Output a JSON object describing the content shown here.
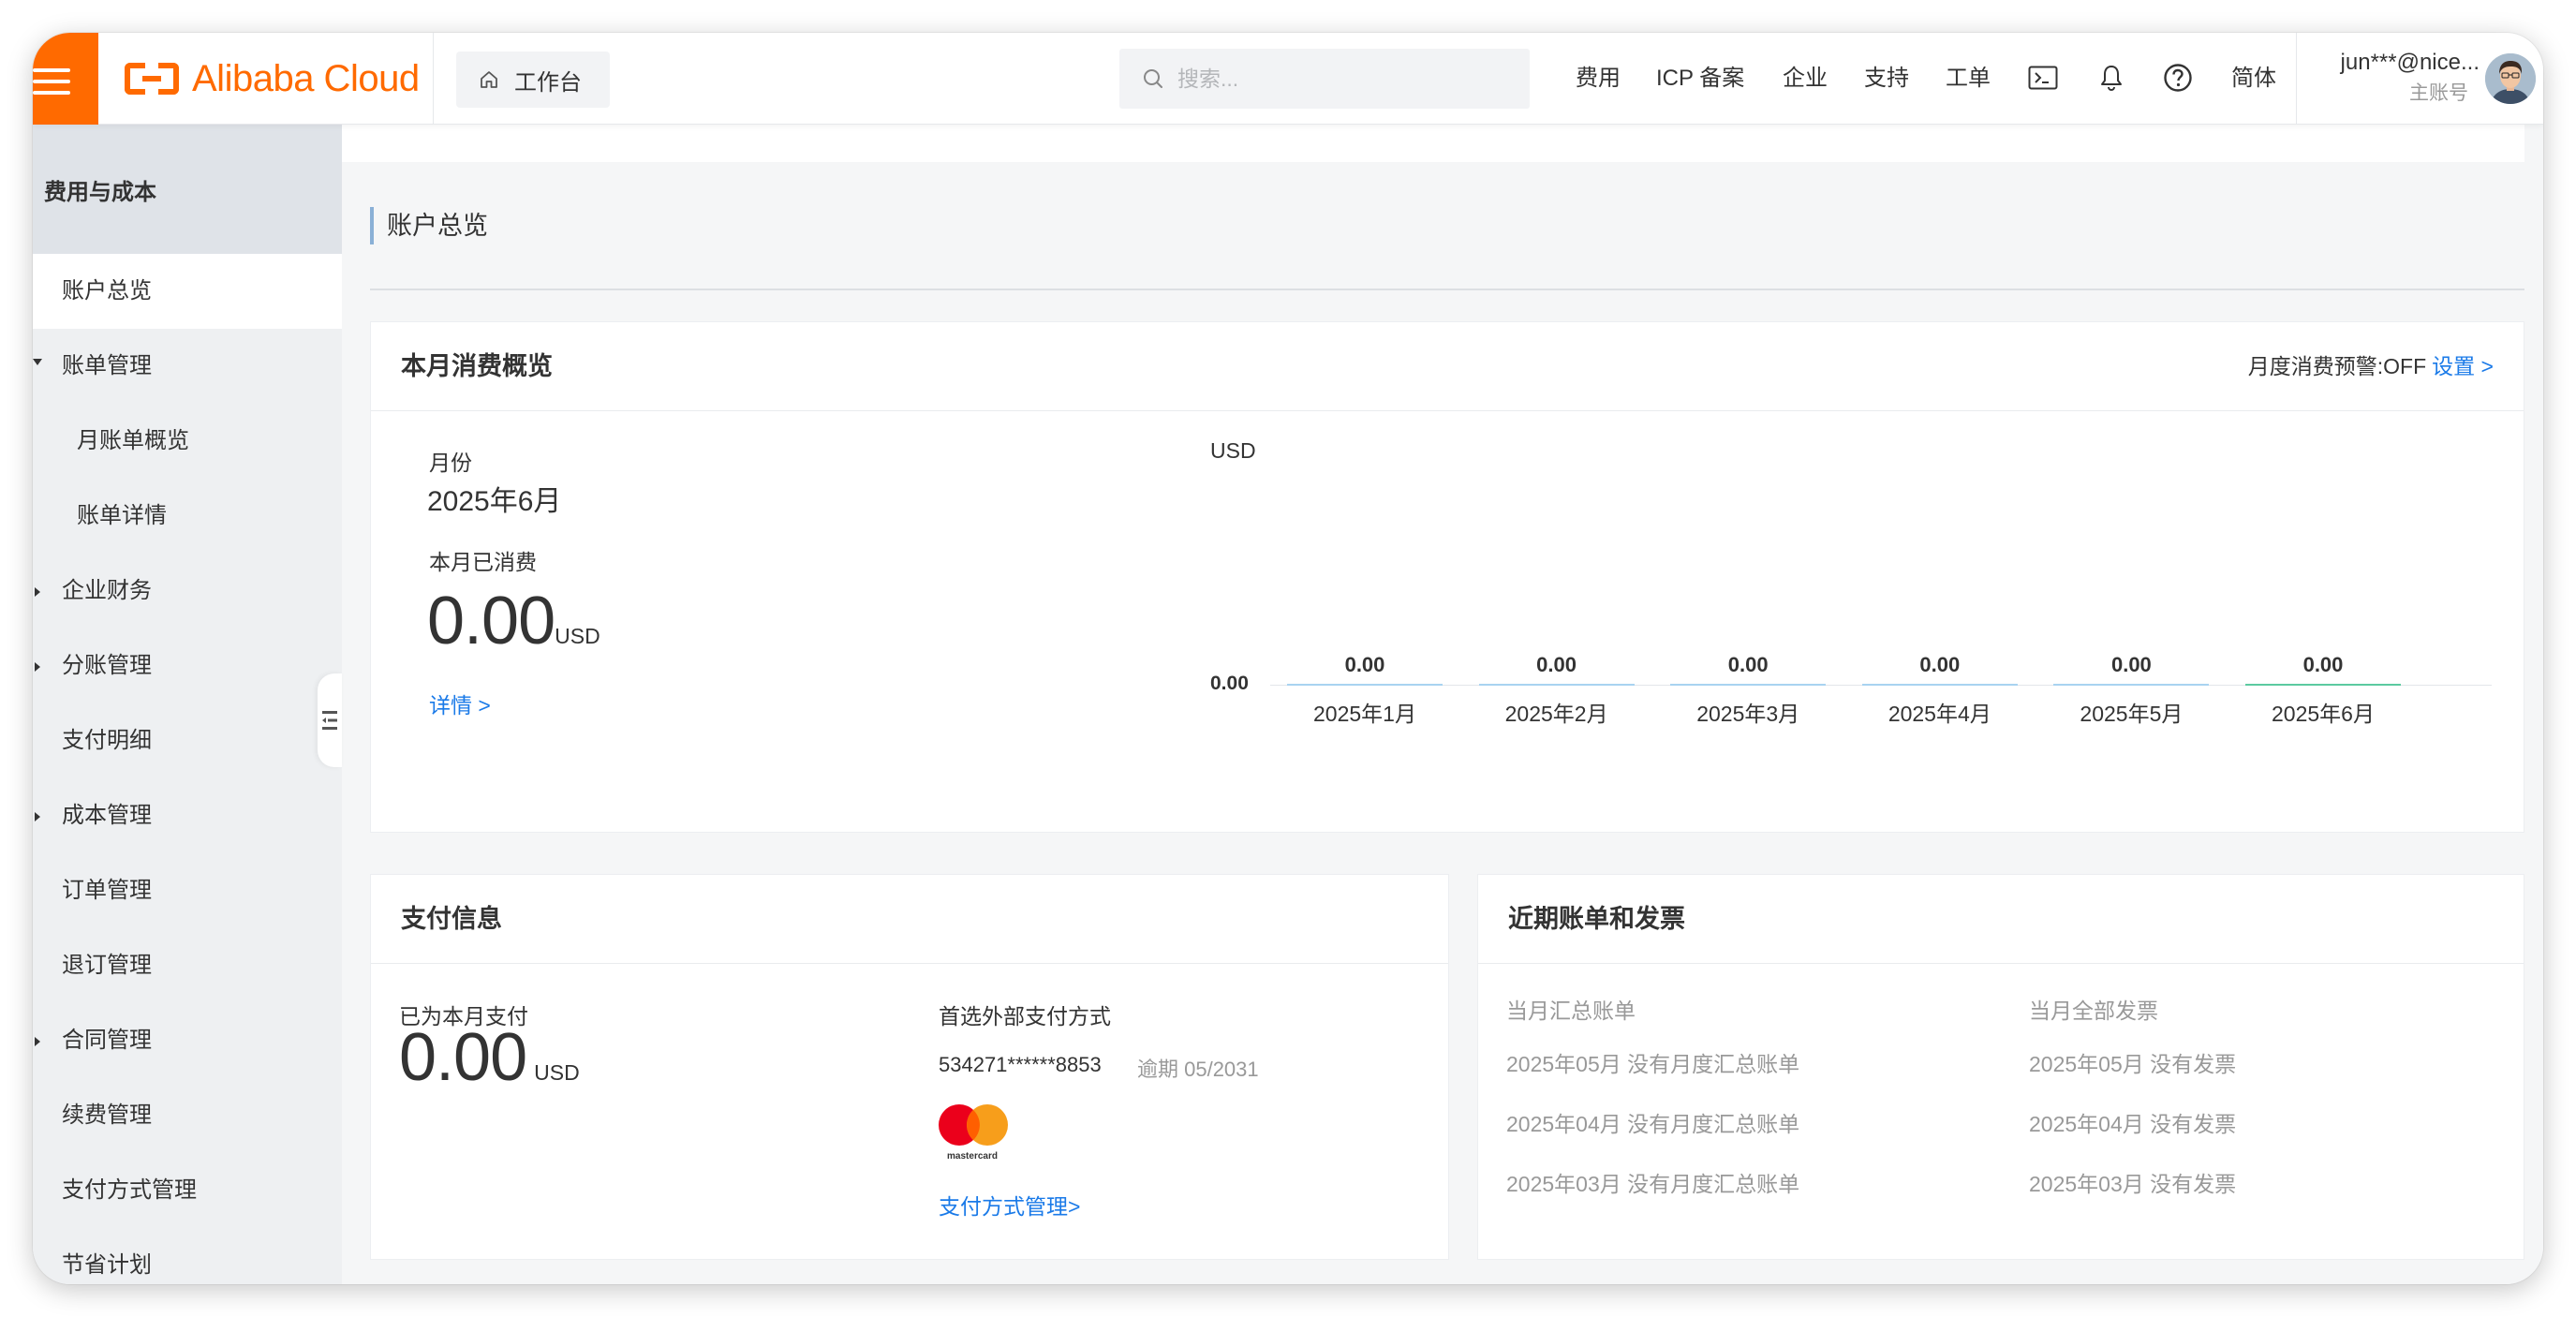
{
  "topbar": {
    "brand": "Alibaba Cloud",
    "workbench": "工作台",
    "search_placeholder": "搜索...",
    "nav": [
      "费用",
      "ICP 备案",
      "企业",
      "支持",
      "工单"
    ],
    "lang": "简体",
    "user_name": "jun***@nice...",
    "user_role": "主账号",
    "icons": [
      "terminal-icon",
      "bell-icon",
      "help-icon"
    ]
  },
  "sidebar": {
    "title": "费用与成本",
    "items": [
      {
        "label": "账户总览",
        "active": true
      },
      {
        "label": "账单管理",
        "expanded": true
      },
      {
        "label": "月账单概览",
        "sub": true
      },
      {
        "label": "账单详情",
        "sub": true
      },
      {
        "label": "企业财务",
        "expandable": true
      },
      {
        "label": "分账管理",
        "expandable": true
      },
      {
        "label": "支付明细"
      },
      {
        "label": "成本管理",
        "expandable": true
      },
      {
        "label": "订单管理"
      },
      {
        "label": "退订管理"
      },
      {
        "label": "合同管理",
        "expandable": true
      },
      {
        "label": "续费管理"
      },
      {
        "label": "支付方式管理"
      },
      {
        "label": "节省计划"
      }
    ]
  },
  "page": {
    "title": "账户总览"
  },
  "monthly": {
    "title": "本月消费概览",
    "alert_label": "月度消费预警:OFF",
    "alert_link": "设置 >",
    "month_label": "月份",
    "month_value": "2025年6月",
    "spent_label": "本月已消费",
    "spent_value": "0.00",
    "currency": "USD",
    "detail_link": "详情 >"
  },
  "chart_data": {
    "type": "bar",
    "ylabel": "USD",
    "y_tick": "0.00",
    "categories": [
      "2025年1月",
      "2025年2月",
      "2025年3月",
      "2025年4月",
      "2025年5月",
      "2025年6月"
    ],
    "values": [
      0,
      0,
      0,
      0,
      0,
      0
    ],
    "data_labels": [
      "0.00",
      "0.00",
      "0.00",
      "0.00",
      "0.00",
      "0.00"
    ],
    "colors": [
      "#a8d3f0",
      "#a8d3f0",
      "#a8d3f0",
      "#a8d3f0",
      "#a8d3f0",
      "#5ccaa0"
    ]
  },
  "payment": {
    "title": "支付信息",
    "paid_label": "已为本月支付",
    "paid_value": "0.00",
    "currency": "USD",
    "method_label": "首选外部支付方式",
    "card_number": "534271******8853",
    "expiry": "逾期 05/2031",
    "card_brand": "mastercard",
    "manage_link": "支付方式管理>"
  },
  "recent": {
    "title": "近期账单和发票",
    "col1_header": "当月汇总账单",
    "col2_header": "当月全部发票",
    "col1": [
      "2025年05月 没有月度汇总账单",
      "2025年04月 没有月度汇总账单",
      "2025年03月 没有月度汇总账单"
    ],
    "col2": [
      "2025年05月 没有发票",
      "2025年04月 没有发票",
      "2025年03月 没有发票"
    ]
  },
  "colors": {
    "brand": "#ff6a00",
    "link": "#1a7ae8"
  }
}
